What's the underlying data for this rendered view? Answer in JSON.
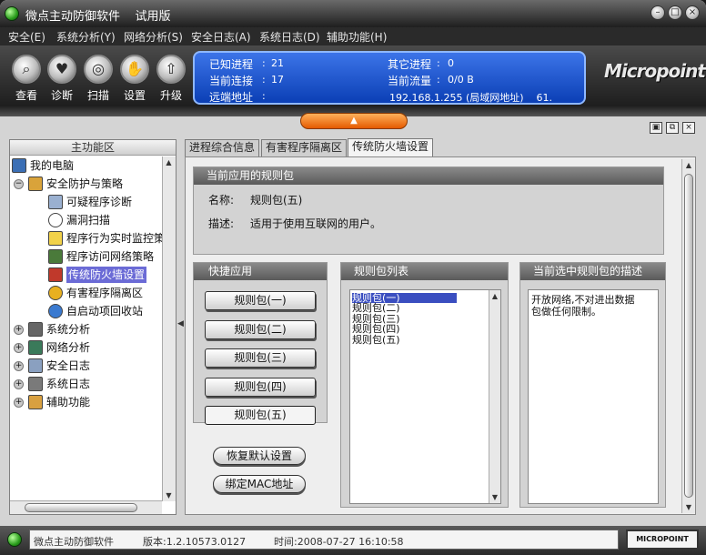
{
  "window": {
    "title": "微点主动防御软件    试用版"
  },
  "menu": [
    "安全(E)",
    "系统分析(Y)",
    "网络分析(S)",
    "安全日志(A)",
    "系统日志(D)",
    "辅助功能(H)"
  ],
  "toolbar": [
    "查看",
    "诊断",
    "扫描",
    "设置",
    "升级"
  ],
  "status": {
    "known_proc_label": "已知进程",
    "known_proc_value": "21",
    "other_proc_label": "其它进程",
    "other_proc_value": "0",
    "conn_label": "当前连接",
    "conn_value": "17",
    "traffic_label": "当前流量",
    "traffic_value": "0/0 B",
    "remote_label": "远端地址",
    "remote_value": "192.168.1.255 (局域网地址)    61."
  },
  "logo": "Micropoint",
  "sidebar": {
    "header": "主功能区",
    "root": "我的电脑",
    "group": "安全防护与策略",
    "items": [
      "可疑程序诊断",
      "漏洞扫描",
      "程序行为实时监控策略",
      "程序访问网络策略",
      "传统防火墙设置",
      "有害程序隔离区",
      "自启动项回收站"
    ],
    "groups": [
      "系统分析",
      "网络分析",
      "安全日志",
      "系统日志",
      "辅助功能"
    ]
  },
  "tabs": [
    "进程综合信息",
    "有害程序隔离区",
    "传统防火墙设置"
  ],
  "rule_pack": {
    "header": "当前应用的规则包",
    "name_label": "名称:",
    "name_value": "规则包(五)",
    "desc_label": "描述:",
    "desc_value": "适用于使用互联网的用户。"
  },
  "quick": {
    "header": "快捷应用",
    "buttons": [
      "规则包(一)",
      "规则包(二)",
      "规则包(三)",
      "规则包(四)",
      "规则包(五)"
    ],
    "restore": "恢复默认设置",
    "bind_mac": "绑定MAC地址"
  },
  "list": {
    "header": "规则包列表",
    "items": [
      "规则包(一)",
      "规则包(二)",
      "规则包(三)",
      "规则包(四)",
      "规则包(五)"
    ]
  },
  "description": {
    "header": "当前选中规则包的描述",
    "text_line1": "开放网络,不对进出数据",
    "text_line2": "包做任何限制。"
  },
  "statusbar": {
    "app": "微点主动防御软件",
    "version": "版本:1.2.10573.0127",
    "time": "时间:2008-07-27 16:10:58",
    "brand": "MICROPOINT"
  }
}
